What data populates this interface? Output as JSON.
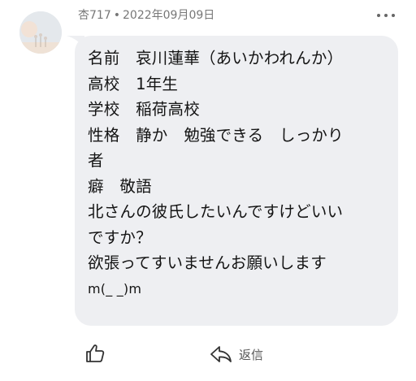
{
  "comment": {
    "author": "杏717",
    "separator": "•",
    "date": "2022年09月09日",
    "lines": [
      "名前　哀川蓮華（あいかわれんか）",
      "高校　1年生",
      "学校　稲荷高校",
      "性格　静か　勉強できる　しっかり",
      "者",
      "癖　敬語",
      "北さんの彼氏したいんですけどいい",
      "ですか？",
      "欲張ってすいませんお願いします",
      "m(_ _)m"
    ]
  },
  "actions": {
    "reply_label": "返信"
  },
  "icons": {
    "more": "more-horizontal-icon",
    "like": "thumbs-up-icon",
    "reply": "reply-arrow-icon"
  },
  "colors": {
    "bubble": "#eeeff2",
    "meta_text": "#777777",
    "text": "#141414"
  }
}
